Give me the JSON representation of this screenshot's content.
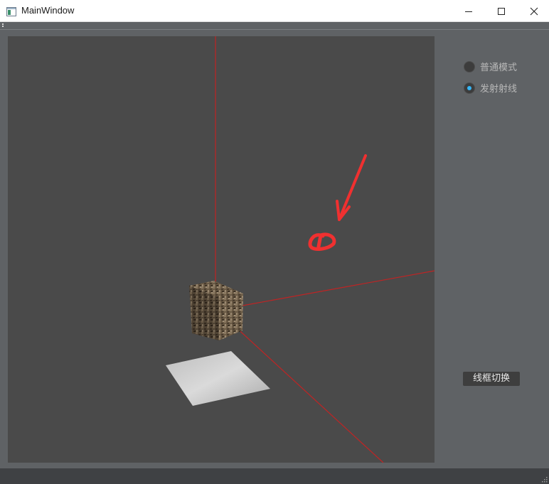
{
  "window": {
    "title": "MainWindow",
    "minimize_icon": "minimize-icon",
    "maximize_icon": "maximize-icon",
    "close_icon": "close-icon"
  },
  "viewport": {
    "background": "#4a4a4a",
    "axis_color": "#c02424",
    "annotation_color": "#f03030",
    "objects": [
      "textured-cube",
      "ground-plane"
    ]
  },
  "panel": {
    "mode_normal_label": "普通模式",
    "mode_ray_label": "发射射线",
    "selected_mode": "发射射线",
    "wireframe_button_label": "线框切换",
    "accent": "#35b5f5"
  }
}
